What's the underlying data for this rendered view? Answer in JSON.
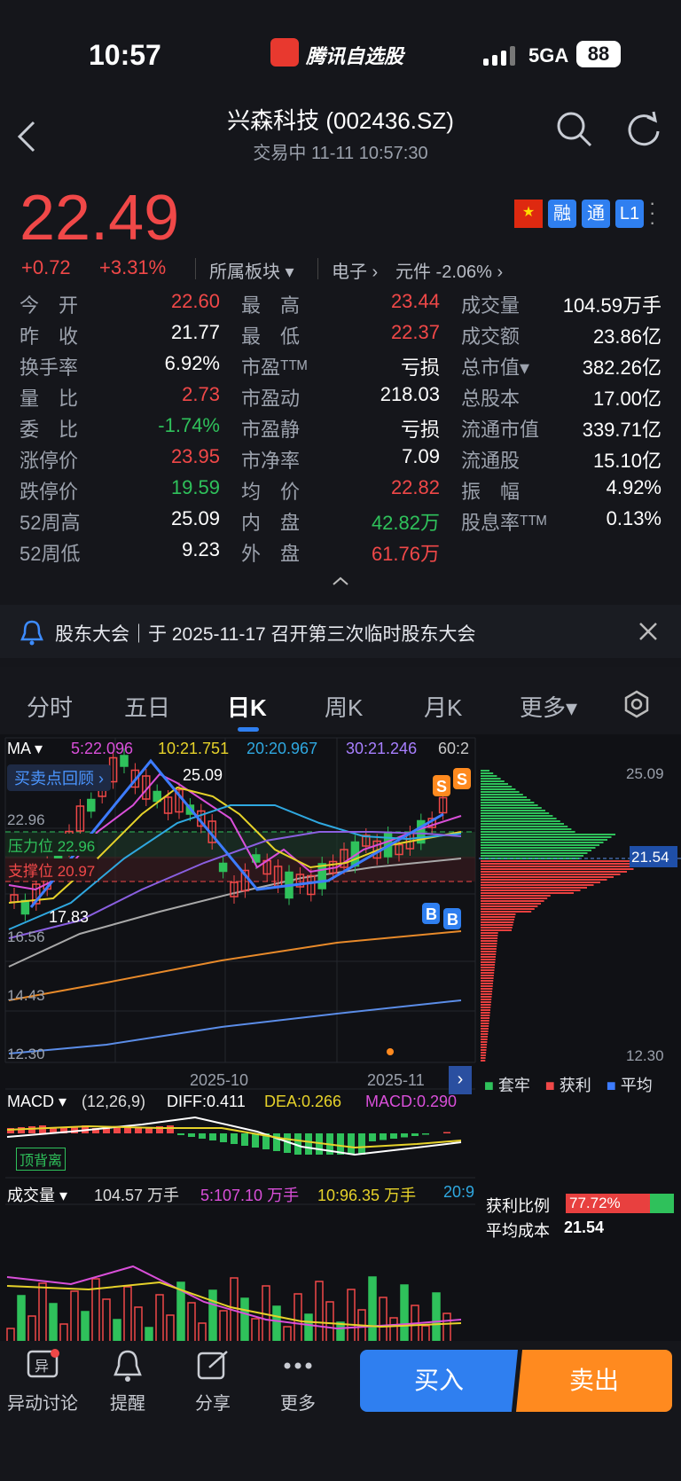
{
  "status": {
    "time": "10:57",
    "app_name": "腾讯自选股",
    "network": "5GA",
    "battery": "88"
  },
  "header": {
    "title": "兴森科技 (002436.SZ)",
    "subtitle": "交易中   11-11 10:57:30"
  },
  "quote": {
    "price": "22.49",
    "change": "+0.72",
    "change_pct": "+3.31%",
    "sector_label": "所属板块",
    "sector1": "电子 ›",
    "sector2": "元件 -2.06% ›",
    "badges": [
      "融",
      "通",
      "L1"
    ],
    "rows": [
      [
        [
          "今　开",
          "22.60",
          "red"
        ],
        [
          "最　高",
          "23.44",
          "red"
        ],
        [
          "成交量",
          "104.59万手",
          "white"
        ]
      ],
      [
        [
          "昨　收",
          "21.77",
          "white"
        ],
        [
          "最　低",
          "22.37",
          "red"
        ],
        [
          "成交额",
          "23.86亿",
          "white"
        ]
      ],
      [
        [
          "换手率",
          "6.92%",
          "white"
        ],
        [
          "市盈ᵀᵀᴹ",
          "亏损",
          "white"
        ],
        [
          "总市值▾",
          "382.26亿",
          "white"
        ]
      ],
      [
        [
          "量　比",
          "2.73",
          "red"
        ],
        [
          "市盈动",
          "218.03",
          "white"
        ],
        [
          "总股本",
          "17.00亿",
          "white"
        ]
      ],
      [
        [
          "委　比",
          "-1.74%",
          "green"
        ],
        [
          "市盈静",
          "亏损",
          "white"
        ],
        [
          "流通市值",
          "339.71亿",
          "white"
        ]
      ],
      [
        [
          "涨停价",
          "23.95",
          "red"
        ],
        [
          "市净率",
          "7.09",
          "white"
        ],
        [
          "流通股",
          "15.10亿",
          "white"
        ]
      ],
      [
        [
          "跌停价",
          "19.59",
          "green"
        ],
        [
          "均　价",
          "22.82",
          "red"
        ],
        [
          "振　幅",
          "4.92%",
          "white"
        ]
      ],
      [
        [
          "52周高",
          "25.09",
          "white"
        ],
        [
          "内　盘",
          "42.82万",
          "green"
        ],
        [
          "股息率ᵀᵀᴹ",
          "0.13%",
          "white"
        ]
      ],
      [
        [
          "52周低",
          "9.23",
          "white"
        ],
        [
          "外　盘",
          "61.76万",
          "red"
        ],
        [
          "",
          "",
          " "
        ]
      ]
    ]
  },
  "notice": {
    "text": "股东大会｜于 2025-11-17 召开第三次临时股东大会"
  },
  "tabs": [
    "分时",
    "五日",
    "日K",
    "周K",
    "月K",
    "更多▾"
  ],
  "chart": {
    "ma_label": "MA ▾",
    "ma5": "5:22.096",
    "ma10": "10:21.751",
    "ma20": "20:20.967",
    "ma30": "30:21.246",
    "ma60": "60:2",
    "review": "买卖点回顾 ›",
    "high_label": "25.09",
    "low_label": "17.83",
    "resistance": "压力位 22.96",
    "support": "支撑位 20.97",
    "y_ticks": [
      "22.96",
      "16.56",
      "14.43",
      "12.30"
    ],
    "x_ticks": [
      "2025-10",
      "2025-11"
    ],
    "right_top": "25.09",
    "right_mid": "21.54",
    "right_bottom": "12.30",
    "legend": [
      "套牢",
      "获利",
      "平均"
    ],
    "macd_label": "MACD ▾",
    "macd_params": "(12,26,9)",
    "diff": "DIFF:0.411",
    "dea": "DEA:0.266",
    "macd": "MACD:0.290",
    "macd_tag": "顶背离",
    "vol_label": "成交量 ▾",
    "vol": "104.57 万手",
    "vol5": "5:107.10 万手",
    "vol10": "10:96.35 万手",
    "vol20": "20:9",
    "profit_label": "获利比例",
    "profit_val": "77.72%",
    "avgcost_label": "平均成本",
    "avgcost_val": "21.54"
  },
  "bottom": {
    "items": [
      "异动讨论",
      "提醒",
      "分享",
      "更多"
    ],
    "buy": "买入",
    "sell": "卖出"
  },
  "colors": {
    "up": "#f04848",
    "down": "#2fc15b",
    "accent": "#2f7ff0",
    "sell": "#ff8a1f"
  }
}
